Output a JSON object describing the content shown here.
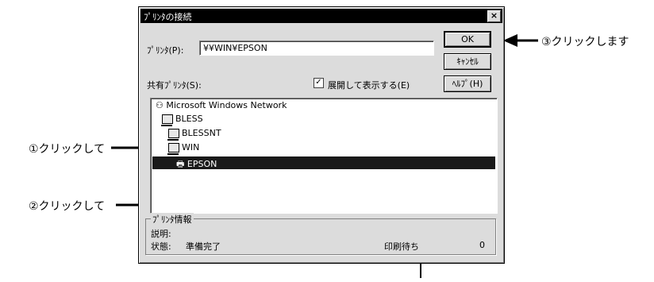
{
  "dialog": {
    "title": "ﾌﾟﾘﾝﾀの接続",
    "close_glyph": "×",
    "printer_label": "ﾌﾟﾘﾝﾀ(P):",
    "printer_value": "¥¥WIN¥EPSON",
    "shared_label": "共有ﾌﾟﾘﾝﾀ(S):",
    "expand_label": "展開して表示する(E)",
    "expand_checked": true,
    "buttons": {
      "ok": "OK",
      "cancel": "ｷｬﾝｾﾙ",
      "help": "ﾍﾙﾌﾟ(H)"
    },
    "tree": {
      "network": "Microsoft Windows Network",
      "bless": "BLESS",
      "blessnt": "BLESSNT",
      "win": "WIN",
      "epson": "EPSON"
    },
    "info": {
      "group_label": "ﾌﾟﾘﾝﾀ情報",
      "desc_label": "説明:",
      "status_label": "状態:",
      "status_value": "準備完了",
      "queue_label": "印刷待ち",
      "queue_value": "0"
    }
  },
  "annotations": {
    "step1": "①クリックして",
    "step2": "②クリックして",
    "step3": "③クリックします"
  }
}
